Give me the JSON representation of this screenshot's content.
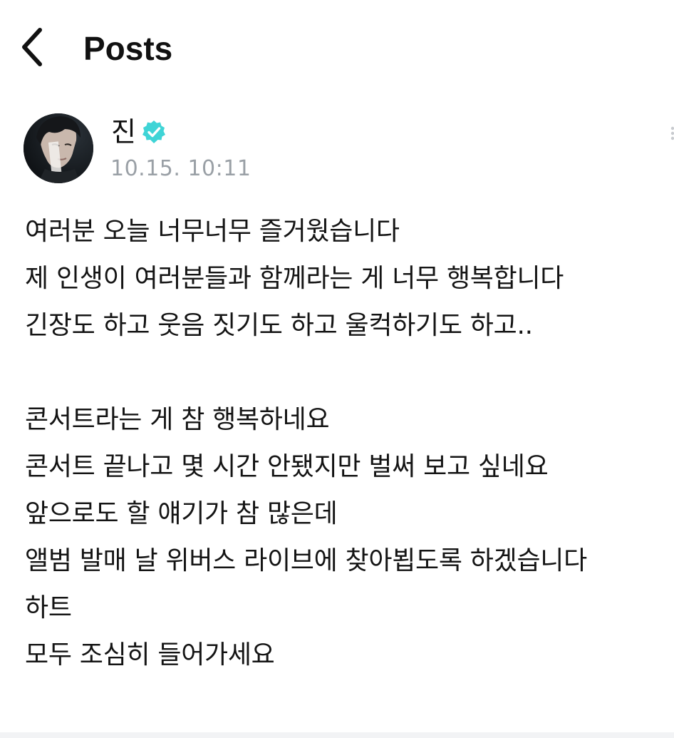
{
  "topbar": {
    "back_icon": "chevron-left-icon",
    "title": "Posts"
  },
  "post": {
    "author": "진",
    "verified_icon": "verified-badge-icon",
    "verified_color": "#3fd4d6",
    "timestamp": "10.15. 10:11",
    "more_icon": "more-icon",
    "lines": [
      "여러분 오늘 너무너무 즐거웠습니다",
      "제 인생이 여러분들과 함께라는 게 너무 행복합니다",
      "긴장도 하고 웃음 짓기도 하고 울컥하기도 하고..",
      "",
      "콘서트라는 게 참 행복하네요",
      "콘서트 끝나고 몇 시간 안됐지만 벌써 보고 싶네요",
      "앞으로도 할 얘기가 참 많은데",
      "앨범 발매 날 위버스 라이브에 찾아뵙도록 하겠습니다",
      "하트",
      "모두 조심히 들어가세요"
    ]
  },
  "colors": {
    "text": "#141414",
    "muted": "#9aa0a6",
    "background": "#ffffff"
  }
}
